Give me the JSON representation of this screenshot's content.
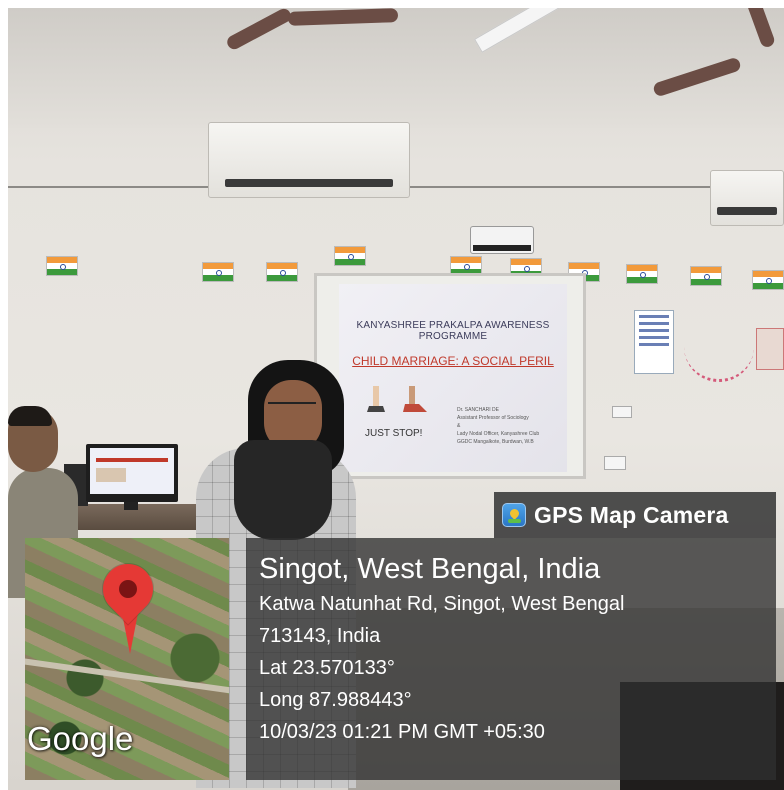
{
  "scene": {
    "slide": {
      "heading": "KANYASHREE PRAKALPA AWARENESS PROGRAMME",
      "topic": "CHILD MARRIAGE: A SOCIAL PERIL",
      "tagline": "JUST STOP!",
      "presenter_lines": [
        "Dr. SANCHARI DE",
        "Assistant Professor of Sociology",
        "&",
        "Lady Nodal Officer, Kanyashree Club",
        "GGDC Mangalkote, Burdwan, W.B"
      ]
    }
  },
  "overlay": {
    "app_icon": "gps-map-camera-icon",
    "app_name": "GPS Map Camera",
    "map_logo": "Google",
    "pin_color": "#e53935",
    "location_title": "Singot, West Bengal, India",
    "address_line1": "Katwa Natunhat Rd, Singot, West Bengal",
    "address_line2": "713143, India",
    "latitude": "Lat 23.570133°",
    "longitude": "Long 87.988443°",
    "timestamp": "10/03/23 01:21 PM GMT +05:30"
  }
}
